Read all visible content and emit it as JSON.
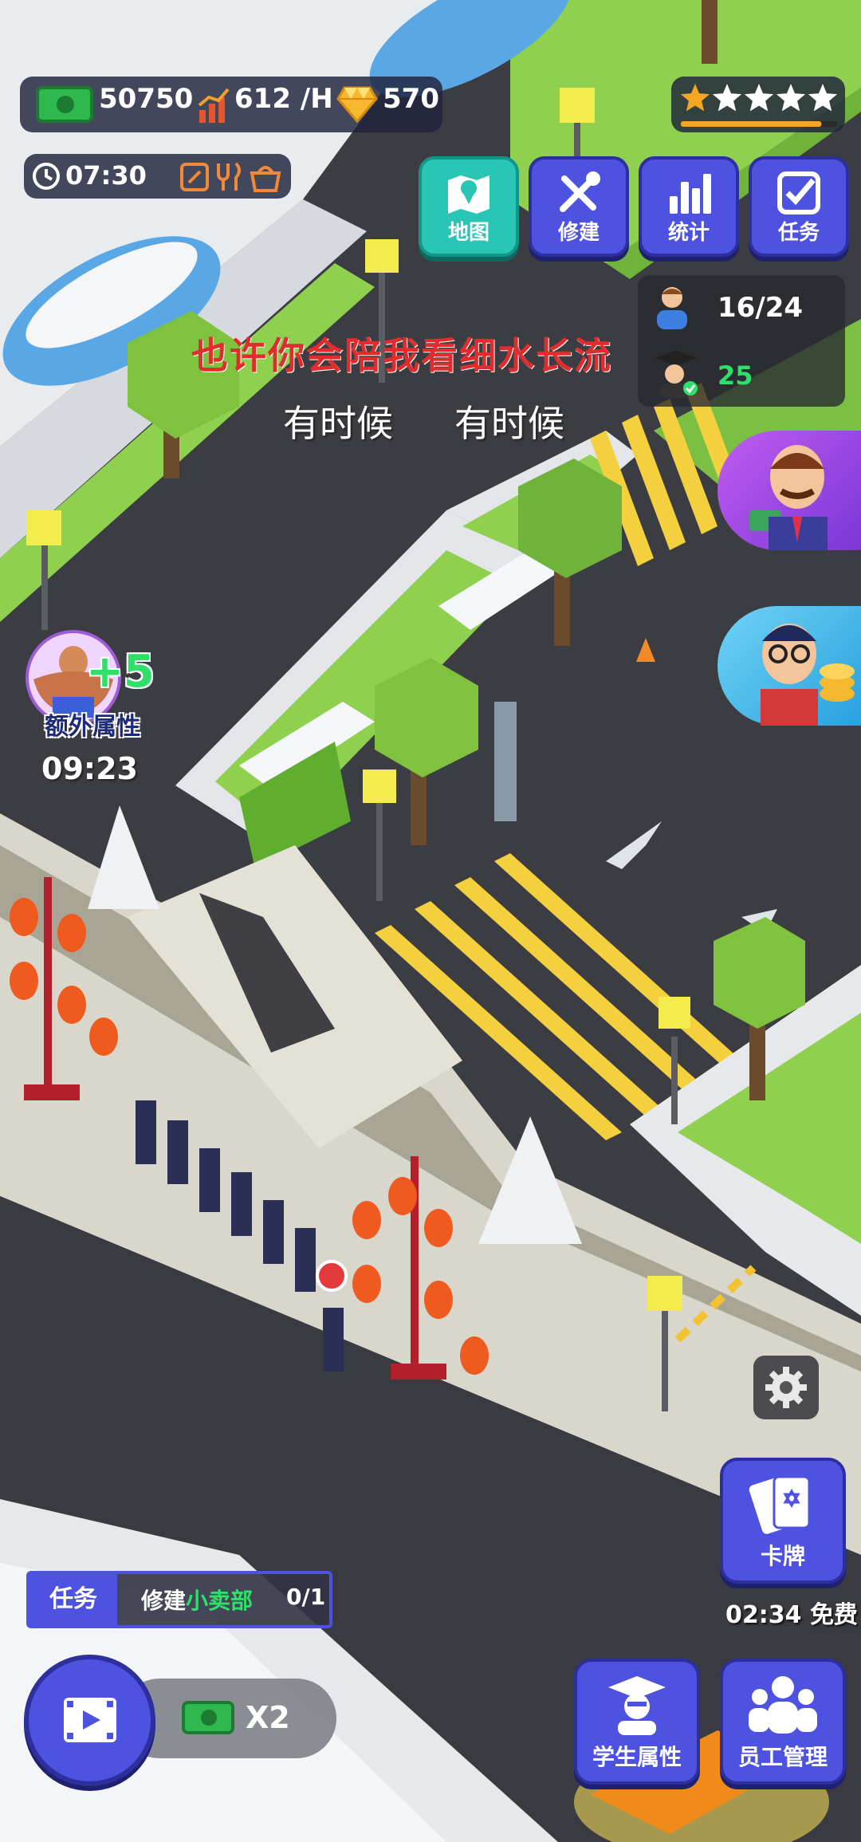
{
  "hud": {
    "money": "50750",
    "income": "612 /H",
    "gems": "570",
    "clock": "07:30",
    "rating_stars": 1,
    "rating_total": 5
  },
  "nav": {
    "map": "地图",
    "build": "修建",
    "stats": "统计",
    "tasks": "任务"
  },
  "students": {
    "count": "16/24",
    "graduates": "25"
  },
  "lyrics": {
    "line1": "也许你会陪我看细水长流",
    "line2a": "有时候",
    "line2b": "有时候"
  },
  "buff": {
    "value": "+5",
    "label": "额外属性",
    "timer": "09:23"
  },
  "cards": {
    "label": "卡牌",
    "timer": "02:34 免费"
  },
  "task": {
    "tag": "任务",
    "prefix": "修建",
    "target": "小卖部",
    "progress": "0/1"
  },
  "boost": {
    "multiplier": "X2"
  },
  "bottom": {
    "student_attr": "学生属性",
    "staff": "员工管理"
  },
  "colors": {
    "button": "#4e52e0",
    "map_button": "#29c6b6",
    "green_text": "#2ee06a",
    "lyric_red": "#e02c2c"
  }
}
